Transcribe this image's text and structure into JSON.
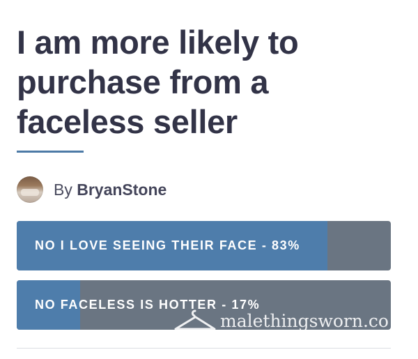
{
  "post": {
    "title": "I am more likely to purchase from a faceless seller",
    "by_prefix": "By",
    "author": "BryanStone"
  },
  "poll": {
    "options": [
      {
        "label": "NO I LOVE SEEING THEIR FACE - 83%",
        "percent": 83
      },
      {
        "label": "NO FACELESS IS HOTTER - 17%",
        "percent": 17
      }
    ]
  },
  "watermark": {
    "text": "malethingsworn.co",
    "icon": "hanger-icon"
  },
  "colors": {
    "title": "#323347",
    "accent": "#4e7dab",
    "bar_track": "#6a7582",
    "underline": "#4d7aa6"
  }
}
